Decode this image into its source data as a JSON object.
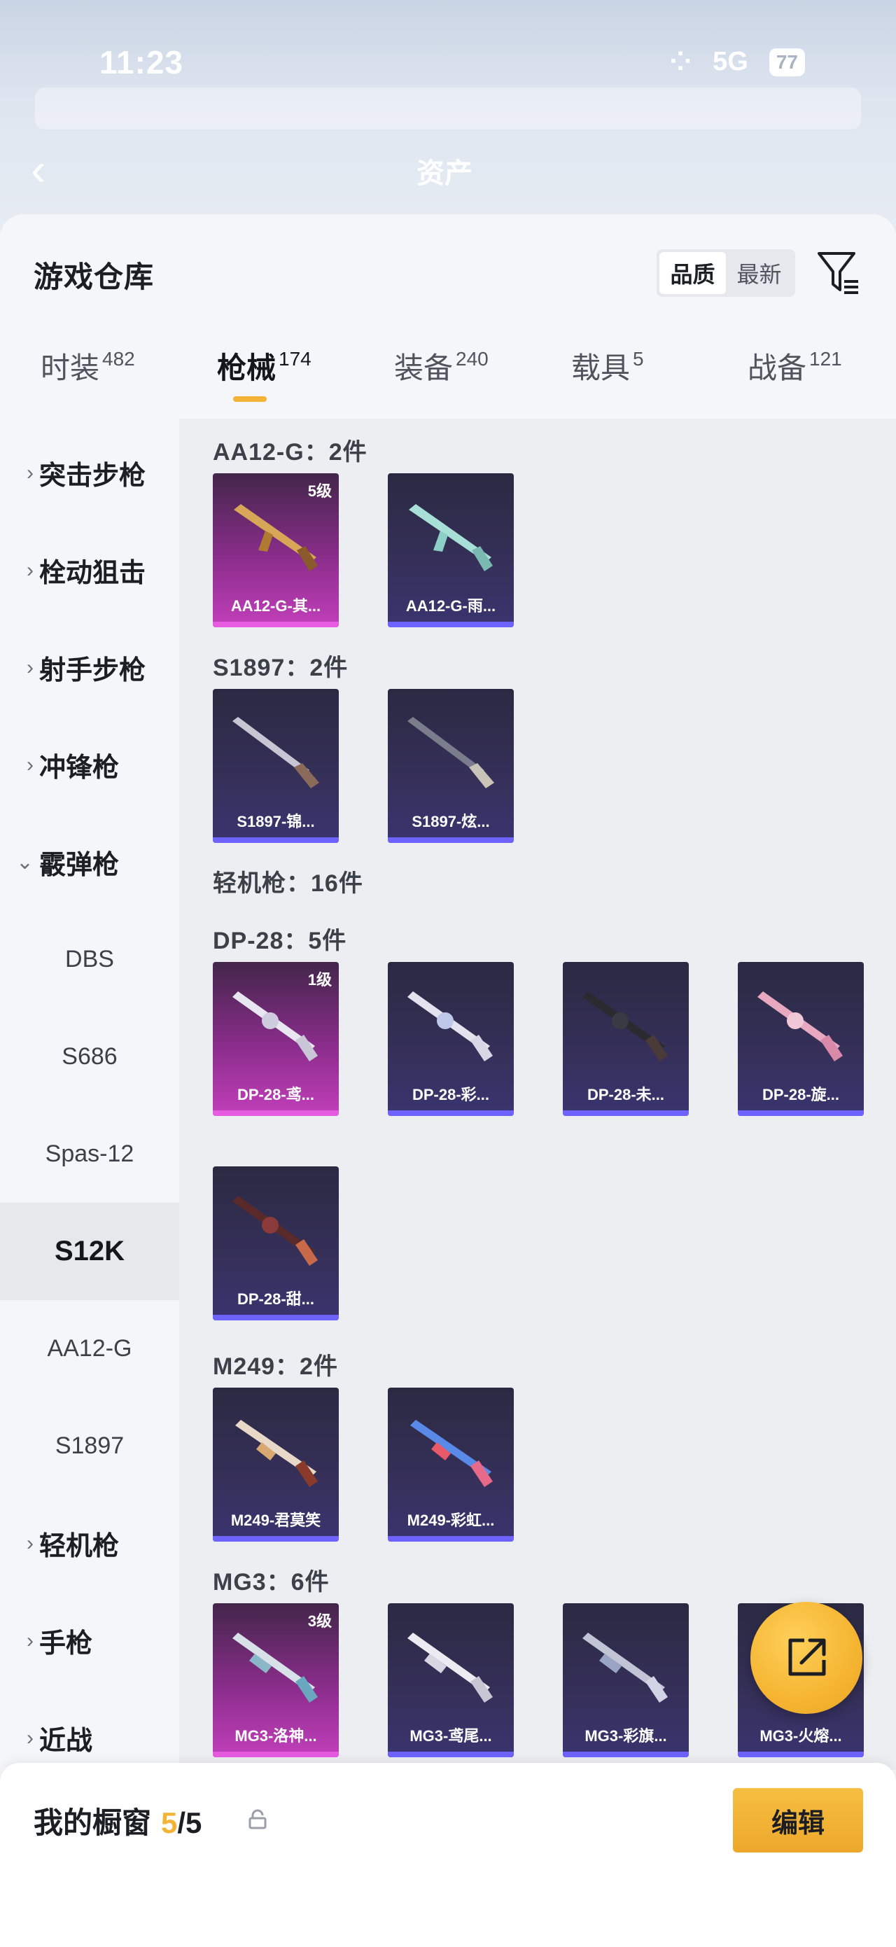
{
  "status_bar": {
    "time": "11:23",
    "network": "5G",
    "battery": "77"
  },
  "background_header": {
    "title": "资产"
  },
  "sheet": {
    "title": "游戏仓库",
    "sort_options": [
      "品质",
      "最新"
    ],
    "sort_selected": "品质"
  },
  "tabs": [
    {
      "label": "时装",
      "count": "482"
    },
    {
      "label": "枪械",
      "count": "174"
    },
    {
      "label": "装备",
      "count": "240"
    },
    {
      "label": "载具",
      "count": "5"
    },
    {
      "label": "战备",
      "count": "121"
    }
  ],
  "sidebar": {
    "categories_top": [
      "突击步枪",
      "栓动狙击",
      "射手步枪",
      "冲锋枪"
    ],
    "expanded": "霰弹枪",
    "subitems": [
      "DBS",
      "S686",
      "Spas-12",
      "S12K",
      "AA12-G",
      "S1897"
    ],
    "selected_sub": "S12K",
    "categories_bottom": [
      "轻机枪",
      "手枪",
      "近战"
    ]
  },
  "groups": [
    {
      "title": "AA12-G：2件",
      "items": [
        {
          "name": "AA12-G-其...",
          "level": "5级",
          "rarity": "purple"
        },
        {
          "name": "AA12-G-雨...",
          "level": "",
          "rarity": "blue"
        }
      ]
    },
    {
      "title": "S1897：2件",
      "items": [
        {
          "name": "S1897-锦...",
          "level": "",
          "rarity": "blue"
        },
        {
          "name": "S1897-炫...",
          "level": "",
          "rarity": "blue"
        }
      ]
    },
    {
      "title": "轻机枪：16件",
      "items": []
    },
    {
      "title": "DP-28：5件",
      "items": [
        {
          "name": "DP-28-鸢...",
          "level": "1级",
          "rarity": "purple"
        },
        {
          "name": "DP-28-彩...",
          "level": "",
          "rarity": "blue"
        },
        {
          "name": "DP-28-未...",
          "level": "",
          "rarity": "blue"
        },
        {
          "name": "DP-28-旋...",
          "level": "",
          "rarity": "blue"
        },
        {
          "name": "DP-28-甜...",
          "level": "",
          "rarity": "blue"
        }
      ]
    },
    {
      "title": "M249：2件",
      "items": [
        {
          "name": "M249-君莫笑",
          "level": "",
          "rarity": "blue"
        },
        {
          "name": "M249-彩虹...",
          "level": "",
          "rarity": "blue"
        }
      ]
    },
    {
      "title": "MG3：6件",
      "items": [
        {
          "name": "MG3-洛神...",
          "level": "3级",
          "rarity": "purple"
        },
        {
          "name": "MG3-鸢尾...",
          "level": "",
          "rarity": "blue"
        },
        {
          "name": "MG3-彩旗...",
          "level": "",
          "rarity": "blue"
        },
        {
          "name": "MG3-火熔...",
          "level": "",
          "rarity": "blue"
        }
      ]
    }
  ],
  "showcase": {
    "title": "我的橱窗",
    "current": "5",
    "separator": "/",
    "total": "5",
    "edit_label": "编辑"
  },
  "icons": {
    "filter": "filter-icon",
    "share": "share-icon",
    "lock": "lock-icon",
    "back": "chevron-left-icon"
  },
  "colors": {
    "accent": "#f3b337",
    "card_blue": "#6e63ff",
    "card_purple": "#e55ce0"
  }
}
